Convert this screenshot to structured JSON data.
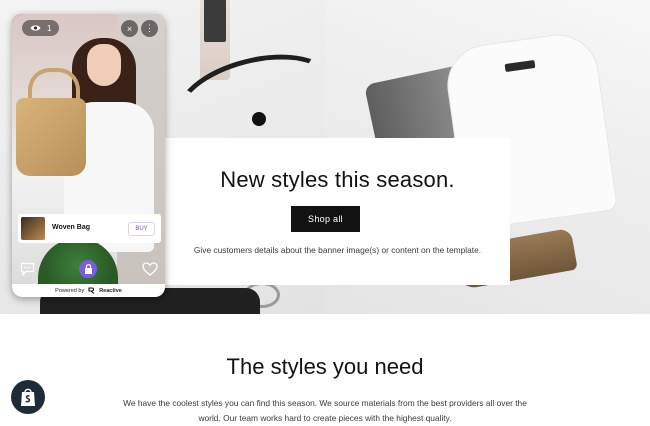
{
  "banner": {
    "title": "New styles this season.",
    "button_label": "Shop all",
    "description": "Give customers details about the banner image(s) or content on the template."
  },
  "section": {
    "title": "The styles you need",
    "body_line1": "We have the coolest styles you can find this season. We source materials from the best providers all over the",
    "body_line2": "world. Our team works hard to create pieces with the highest quality."
  },
  "widget": {
    "view_count": "1",
    "close_symbol": "×",
    "more_symbol": "⋮",
    "product": {
      "name": "Woven Bag",
      "buy_label": "BUY"
    },
    "footer_prefix": "Powered by",
    "footer_brand": "Reactive",
    "accent_color": "#6b4fd6"
  },
  "icons": [
    "eye-icon",
    "close-icon",
    "more-icon",
    "chat-icon",
    "lock-bag-icon",
    "heart-icon",
    "reactive-logo-icon",
    "shopify-bag-icon"
  ]
}
